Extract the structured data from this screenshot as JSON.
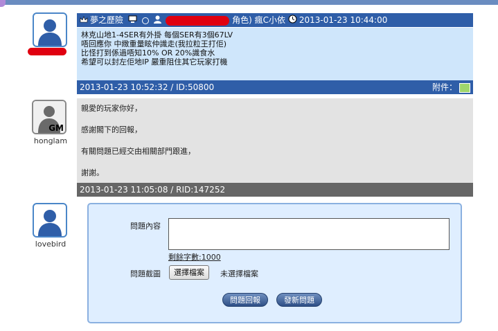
{
  "post1": {
    "player_name": "夢之歷險",
    "role_suffix": "角色)",
    "server": "瘋C小依",
    "header_time": "2013-01-23 10:44:00",
    "lines": [
      "林克山地1-4SER有外掛 每個SER有3個67LV",
      "唔回應你 中緻重量眩仲識走(我拉粒王打佢)",
      "比怪打到係過唔知10% OR 20%識食水",
      "希望可以封左佢地IP 嚴重阻住其它玩家打機"
    ],
    "footer": "2013-01-23 10:52:32 / ID:50800",
    "attachment_label": "附件："
  },
  "reply": {
    "username": "honglam",
    "avatar_badge": "GM",
    "lines": [
      "親愛的玩家你好，",
      "感謝閣下的回報，",
      "有關問題已經交由相關部門跟進，",
      "謝謝。"
    ],
    "footer": "2013-01-23 11:05:08 / RID:147252"
  },
  "form": {
    "username": "lovebird",
    "content_label": "問題內容",
    "remaining": "剩餘字數:1000",
    "screenshot_label": "問題截圖",
    "file_button": "選擇檔案",
    "no_file": "未選擇檔案",
    "reply_button": "問題回報",
    "new_button": "發新問題"
  }
}
